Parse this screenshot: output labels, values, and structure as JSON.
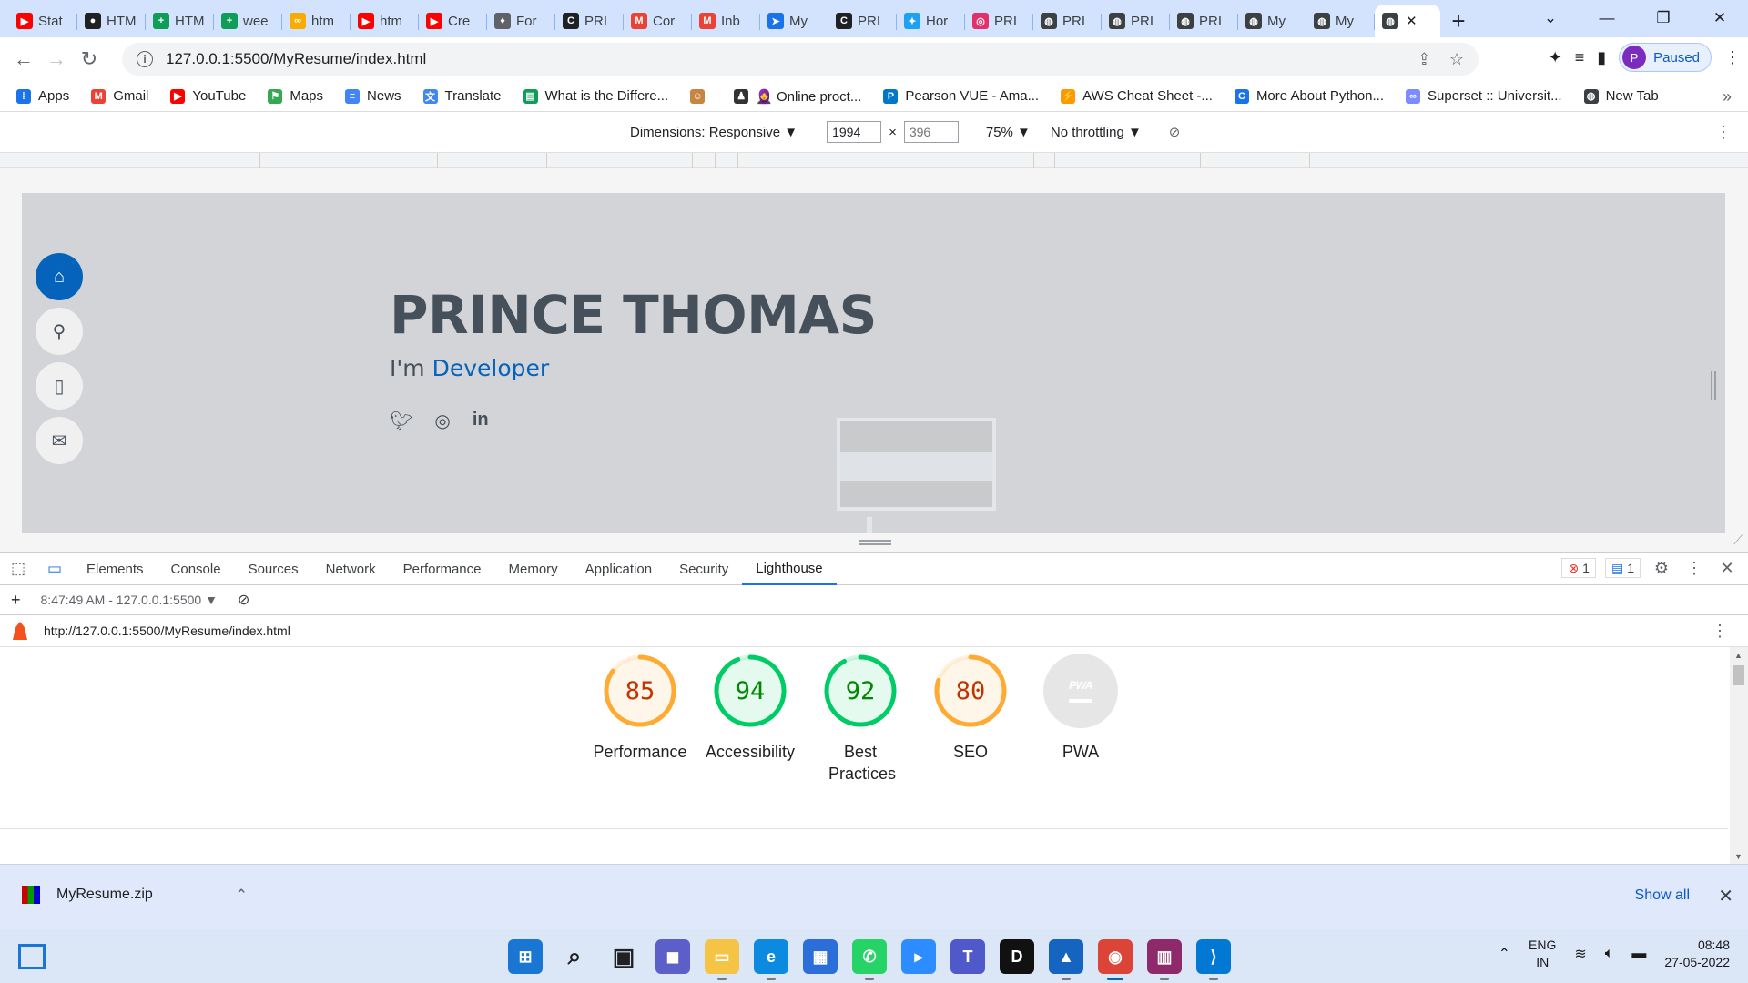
{
  "tabs": [
    {
      "title": "Stat",
      "icon": "youtube-icon",
      "color": "#ff0000"
    },
    {
      "title": "HTM",
      "icon": "github-icon",
      "color": "#202124"
    },
    {
      "title": "HTM",
      "icon": "sheets-icon",
      "color": "#0f9d58"
    },
    {
      "title": "wee",
      "icon": "sheets-icon",
      "color": "#0f9d58"
    },
    {
      "title": "htm",
      "icon": "colab-icon",
      "color": "#f9ab00"
    },
    {
      "title": "htm",
      "icon": "youtube-icon",
      "color": "#ff0000"
    },
    {
      "title": "Cre",
      "icon": "youtube-icon",
      "color": "#ff0000"
    },
    {
      "title": "For",
      "icon": "forum-icon",
      "color": "#5f6368"
    },
    {
      "title": "PRI",
      "icon": "codechef-icon",
      "color": "#202124"
    },
    {
      "title": "Cor",
      "icon": "gmail-icon",
      "color": "#ea4335"
    },
    {
      "title": "Inb",
      "icon": "gmail-icon",
      "color": "#ea4335"
    },
    {
      "title": "My",
      "icon": "app-icon",
      "color": "#1a73e8"
    },
    {
      "title": "PRI",
      "icon": "codechef-icon",
      "color": "#202124"
    },
    {
      "title": "Hor",
      "icon": "twitter-icon",
      "color": "#1da1f2"
    },
    {
      "title": "PRI",
      "icon": "instagram-icon",
      "color": "#e1306c"
    },
    {
      "title": "PRI",
      "icon": "globe-icon",
      "color": "#3c4043"
    },
    {
      "title": "PRI",
      "icon": "globe-icon",
      "color": "#3c4043"
    },
    {
      "title": "PRI",
      "icon": "globe-icon",
      "color": "#3c4043"
    },
    {
      "title": "My",
      "icon": "globe-icon",
      "color": "#3c4043"
    },
    {
      "title": "My",
      "icon": "globe-icon",
      "color": "#3c4043"
    }
  ],
  "active_tab": {
    "icon": "globe-icon"
  },
  "address": {
    "url": "127.0.0.1:5500/MyResume/index.html"
  },
  "profile": {
    "initial": "P",
    "status": "Paused"
  },
  "bookmarks": [
    {
      "label": "Apps",
      "icon": "apps-grid-icon",
      "color": "#1a73e8"
    },
    {
      "label": "Gmail",
      "icon": "gmail-icon",
      "color": "#ea4335"
    },
    {
      "label": "YouTube",
      "icon": "youtube-icon",
      "color": "#ff0000"
    },
    {
      "label": "Maps",
      "icon": "maps-icon",
      "color": "#34a853"
    },
    {
      "label": "News",
      "icon": "news-icon",
      "color": "#4285f4"
    },
    {
      "label": "Translate",
      "icon": "translate-icon",
      "color": "#4285f4"
    },
    {
      "label": "What is the Differe...",
      "icon": "page-icon",
      "color": "#0f9d58"
    },
    {
      "label": "",
      "icon": "avatar-icon",
      "color": "#c68642"
    },
    {
      "label": "🧕 Online proct...",
      "icon": "person-icon",
      "color": "#333333"
    },
    {
      "label": "Pearson VUE - Ama...",
      "icon": "pearson-icon",
      "color": "#0077c8"
    },
    {
      "label": "AWS Cheat Sheet -...",
      "icon": "aws-icon",
      "color": "#ff9900"
    },
    {
      "label": "More About Python...",
      "icon": "c-icon",
      "color": "#1a73e8"
    },
    {
      "label": "Superset :: Universit...",
      "icon": "superset-icon",
      "color": "#7a8cff"
    },
    {
      "label": "New Tab",
      "icon": "globe-icon",
      "color": "#3c4043"
    }
  ],
  "device_toolbar": {
    "dimensions_label": "Dimensions: Responsive ▼",
    "width": "1994",
    "height_placeholder": "396",
    "zoom": "75% ▼",
    "throttling": "No throttling ▼"
  },
  "site": {
    "name": "PRINCE THOMAS",
    "intro": "I'm",
    "role": "Developer",
    "nav": [
      "home-icon",
      "person-icon",
      "file-icon",
      "envelope-icon"
    ],
    "social": [
      "twitter-icon",
      "instagram-icon",
      "linkedin-icon"
    ],
    "accent": "#0563bb"
  },
  "devtools": {
    "tabs": [
      "Elements",
      "Console",
      "Sources",
      "Network",
      "Performance",
      "Memory",
      "Application",
      "Security",
      "Lighthouse"
    ],
    "active_tab": "Lighthouse",
    "errors": "1",
    "messages": "1",
    "report_time": "8:47:49 AM - 127.0.0.1:5500 ▼",
    "report_url": "http://127.0.0.1:5500/MyResume/index.html"
  },
  "lighthouse": {
    "scores": [
      {
        "label": "Performance",
        "score": 85,
        "color": "#fa3",
        "text_color": "#c33300"
      },
      {
        "label": "Accessibility",
        "score": 94,
        "color": "#0c6",
        "text_color": "#008800"
      },
      {
        "label": "Best Practices",
        "score": 92,
        "color": "#0c6",
        "text_color": "#008800"
      },
      {
        "label": "SEO",
        "score": 80,
        "color": "#fa3",
        "text_color": "#c33300"
      }
    ],
    "pwa": {
      "label": "PWA",
      "badge": "PWA"
    }
  },
  "download": {
    "file": "MyResume.zip",
    "show_all": "Show all"
  },
  "taskbar": {
    "apps": [
      {
        "name": "start-icon",
        "color": "#1976d2"
      },
      {
        "name": "search-icon",
        "color": "#202124"
      },
      {
        "name": "task-view-icon",
        "color": "#202124"
      },
      {
        "name": "chat-icon",
        "color": "#5b5fc7"
      },
      {
        "name": "file-explorer-icon",
        "color": "#f6c445"
      },
      {
        "name": "edge-icon",
        "color": "#0c8ae0"
      },
      {
        "name": "store-icon",
        "color": "#2b6ed9"
      },
      {
        "name": "whatsapp-icon",
        "color": "#25d366"
      },
      {
        "name": "zoom-icon",
        "color": "#2d8cff"
      },
      {
        "name": "teams-icon",
        "color": "#5059c9"
      },
      {
        "name": "dell-icon",
        "color": "#111111"
      },
      {
        "name": "photos-icon",
        "color": "#1565c0"
      },
      {
        "name": "chrome-icon",
        "color": "#db4437"
      },
      {
        "name": "winrar-icon",
        "color": "#8e2a6a"
      },
      {
        "name": "vscode-icon",
        "color": "#0078d4"
      }
    ],
    "lang_top": "ENG",
    "lang_bottom": "IN",
    "time": "08:48",
    "date": "27-05-2022"
  }
}
